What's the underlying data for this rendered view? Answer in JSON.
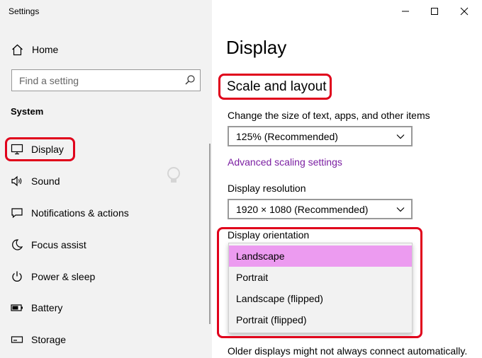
{
  "window": {
    "title": "Settings",
    "controls": [
      "minimize",
      "maximize",
      "close"
    ]
  },
  "sidebar": {
    "home_label": "Home",
    "search": {
      "placeholder": "Find a setting"
    },
    "section": "System",
    "items": [
      {
        "label": "Display",
        "icon": "monitor-icon",
        "active": true
      },
      {
        "label": "Sound",
        "icon": "speaker-icon"
      },
      {
        "label": "Notifications & actions",
        "icon": "message-icon"
      },
      {
        "label": "Focus assist",
        "icon": "moon-icon"
      },
      {
        "label": "Power & sleep",
        "icon": "power-icon"
      },
      {
        "label": "Battery",
        "icon": "battery-icon"
      },
      {
        "label": "Storage",
        "icon": "storage-icon"
      }
    ]
  },
  "main": {
    "title": "Display",
    "section_heading": "Scale and layout",
    "scale_label": "Change the size of text, apps, and other items",
    "scale_value": "125% (Recommended)",
    "advanced_link": "Advanced scaling settings",
    "resolution_label": "Display resolution",
    "resolution_value": "1920 × 1080 (Recommended)",
    "orientation_label": "Display orientation",
    "orientation_options": [
      {
        "label": "Landscape",
        "selected": true
      },
      {
        "label": "Portrait"
      },
      {
        "label": "Landscape (flipped)"
      },
      {
        "label": "Portrait (flipped)"
      }
    ],
    "footer_note": "Older displays might not always connect automatically."
  },
  "colors": {
    "accent": "#7b1fa2",
    "highlight_box": "#e0001b",
    "selected_option": "#ec9bf0",
    "sidebar_bg": "#f2f2f2"
  }
}
